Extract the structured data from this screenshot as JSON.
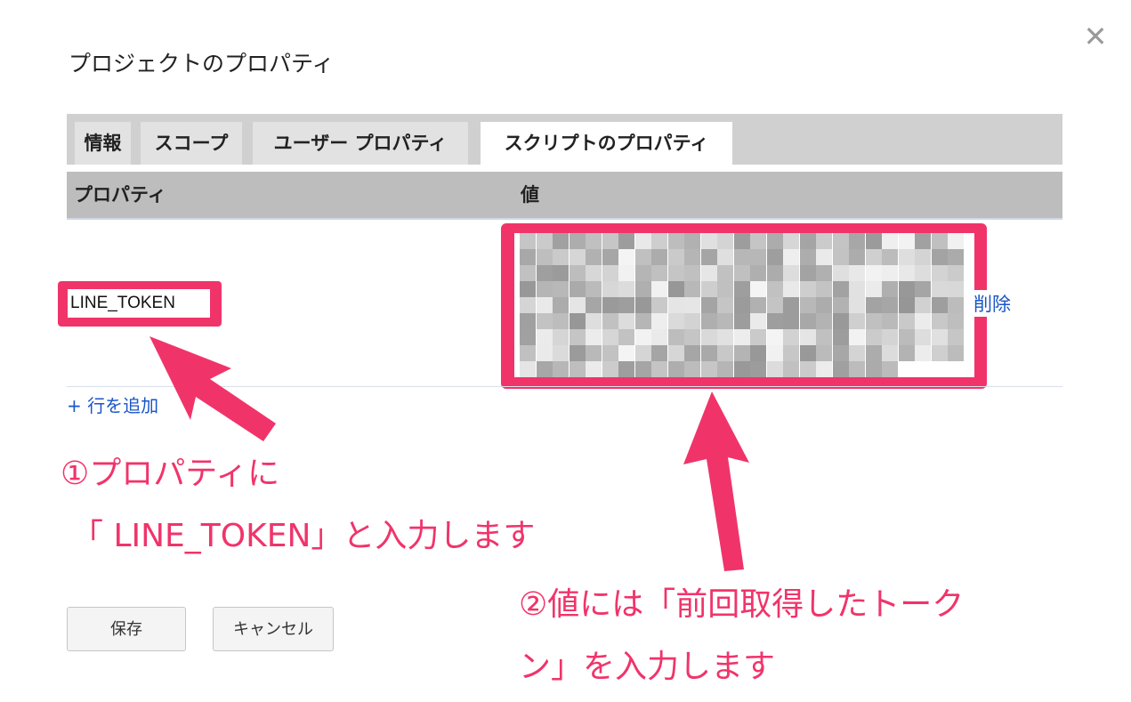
{
  "dialog": {
    "title": "プロジェクトのプロパティ",
    "close_icon": "close-icon"
  },
  "tabs": [
    {
      "label": "情報",
      "active": false
    },
    {
      "label": "スコープ",
      "active": false
    },
    {
      "label": "ユーザー プロパティ",
      "active": false
    },
    {
      "label": "スクリプトのプロパティ",
      "active": true
    }
  ],
  "table": {
    "headers": [
      "プロパティ",
      "値"
    ],
    "rows": [
      {
        "property": "LINE_TOKEN",
        "value": "",
        "delete_label": "削除"
      }
    ],
    "add_row_label": "+ 行を追加"
  },
  "annotations": {
    "step1_line1": "①プロパティに",
    "step1_line2": "「 LINE_TOKEN」と入力します",
    "step2_line1": "②値には「前回取得したトーク",
    "step2_line2": "ン」を入力します"
  },
  "buttons": {
    "save": "保存",
    "cancel": "キャンセル"
  },
  "colors": {
    "highlight": "#f0346a",
    "link": "#1a55c8"
  }
}
